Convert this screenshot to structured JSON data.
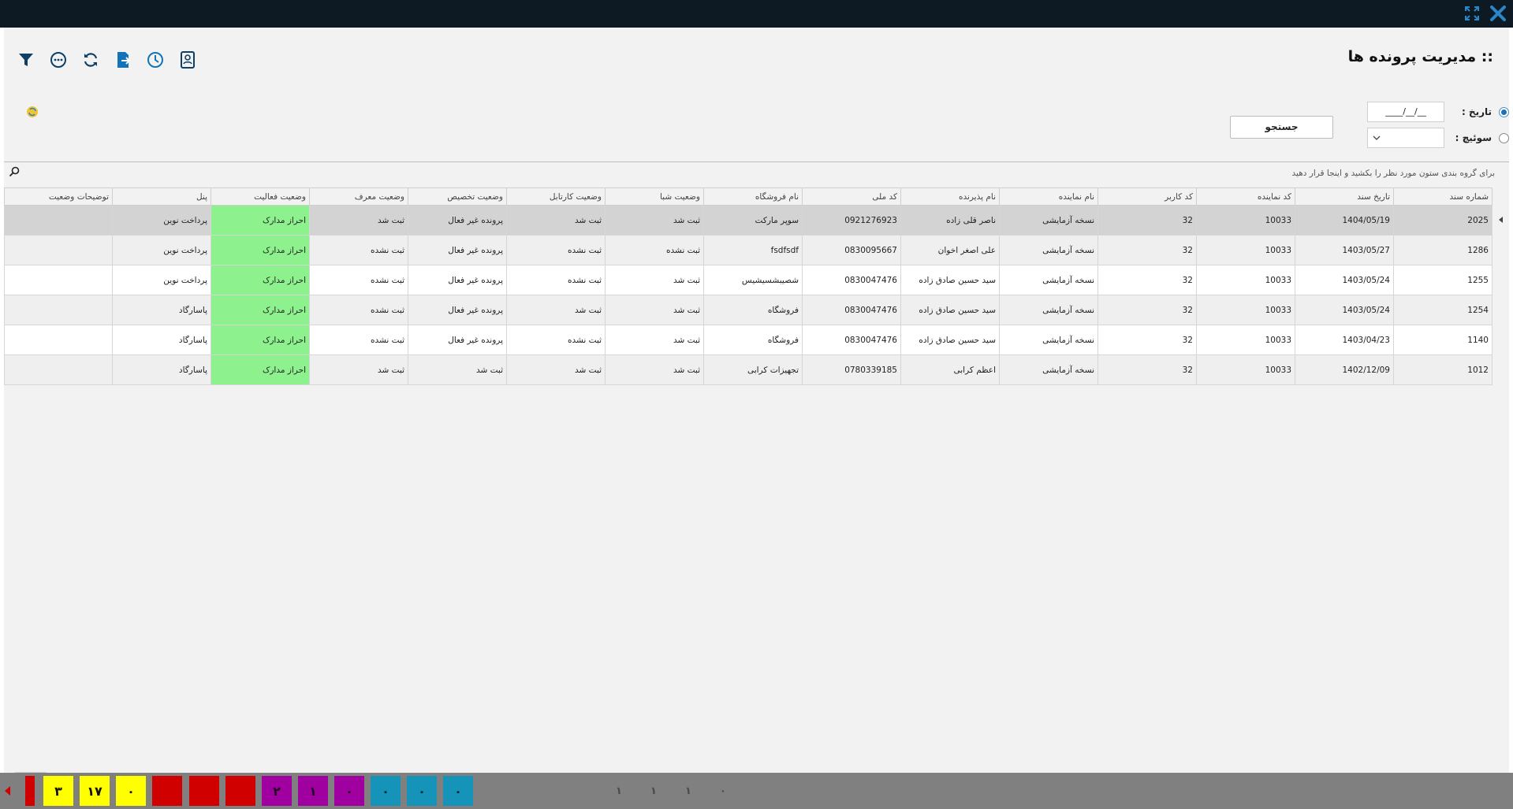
{
  "page": {
    "title": ":: مدیریت پرونده ها"
  },
  "toolbar": {
    "icons": [
      "filter-icon",
      "more-icon",
      "refresh-icon",
      "export-icon",
      "history-icon",
      "contact-card-icon"
    ]
  },
  "filters": {
    "date_label": "تاریخ :",
    "date_value": "__/__/____",
    "switch_label": "سوئیچ :",
    "switch_value": "",
    "search_button": "جستجو"
  },
  "group_hint": "برای گروه بندی ستون مورد نظر را بکشید و اینجا قرار دهید",
  "table": {
    "columns": [
      "شماره سند",
      "تاریخ سند",
      "کد نماینده",
      "کد کاربر",
      "نام نماینده",
      "نام پذیرنده",
      "کد ملی",
      "نام فروشگاه",
      "وضعیت شبا",
      "وضعیت کارتابل",
      "وضعیت تخصیص",
      "وضعیت معرف",
      "وضعیت فعالیت",
      "پنل",
      "توضیحات وضعیت"
    ],
    "rows": [
      [
        "2025",
        "1404/05/19",
        "10033",
        "32",
        "نسخه آزمایشی",
        "ناصر قلی زاده",
        "0921276923",
        "سوپر مارکت",
        "ثبت شد",
        "ثبت شد",
        "پرونده غیر فعال",
        "ثبت شد",
        "احراز مدارک",
        "پرداخت نوین",
        ""
      ],
      [
        "1286",
        "1403/05/27",
        "10033",
        "32",
        "نسخه آزمایشی",
        "علی اصغر اخوان",
        "0830095667",
        "fsdfsdf",
        "ثبت نشده",
        "ثبت نشده",
        "پرونده غیر فعال",
        "ثبت نشده",
        "احراز مدارک",
        "پرداخت نوین",
        ""
      ],
      [
        "1255",
        "1403/05/24",
        "10033",
        "32",
        "نسخه آزمایشی",
        "سید حسین صادق زاده",
        "0830047476",
        "شصیبشسیشیس",
        "ثبت شد",
        "ثبت نشده",
        "پرونده غیر فعال",
        "ثبت نشده",
        "احراز مدارک",
        "پرداخت نوین",
        ""
      ],
      [
        "1254",
        "1403/05/24",
        "10033",
        "32",
        "نسخه آزمایشی",
        "سید حسین صادق زاده",
        "0830047476",
        "فروشگاه",
        "ثبت شد",
        "ثبت شد",
        "پرونده غیر فعال",
        "ثبت نشده",
        "احراز مدارک",
        "پاسارگاد",
        ""
      ],
      [
        "1140",
        "1403/04/23",
        "10033",
        "32",
        "نسخه آزمایشی",
        "سید حسین صادق زاده",
        "0830047476",
        "فروشگاه",
        "ثبت شد",
        "ثبت نشده",
        "پرونده غیر فعال",
        "ثبت نشده",
        "احراز مدارک",
        "پاسارگاد",
        ""
      ],
      [
        "1012",
        "1402/12/09",
        "10033",
        "32",
        "نسخه آزمایشی",
        "اعظم  کرابی",
        "0780339185",
        "تجهیزات کرابی",
        "ثبت شد",
        "ثبت شد",
        "ثبت شد",
        "ثبت شد",
        "احراز مدارک",
        "پاسارگاد",
        ""
      ]
    ]
  },
  "taskbar": {
    "tiles": [
      {
        "color": "yellow",
        "label": "۳"
      },
      {
        "color": "yellow",
        "label": "۱۷"
      },
      {
        "color": "yellow",
        "label": "۰"
      },
      {
        "color": "red",
        "label": ""
      },
      {
        "color": "red",
        "label": ""
      },
      {
        "color": "red",
        "label": ""
      },
      {
        "color": "purple",
        "label": "۲"
      },
      {
        "color": "purple",
        "label": "۱"
      },
      {
        "color": "purple",
        "label": "۰"
      },
      {
        "color": "teal",
        "label": "۰"
      },
      {
        "color": "teal",
        "label": "۰"
      },
      {
        "color": "teal",
        "label": "۰"
      }
    ],
    "mid_icons": [
      {
        "name": "document-count-icon",
        "label": "۱"
      },
      {
        "name": "timer-count-icon",
        "label": "۱"
      },
      {
        "name": "search-count-icon",
        "label": "۱"
      },
      {
        "name": "edit-count-icon",
        "label": "۰"
      }
    ]
  },
  "colors": {
    "topbar": "#0d1a24",
    "accent": "#1d6fb8",
    "status_green": "#8df28d",
    "tile_yellow": "#ffff00",
    "tile_red": "#d10000",
    "tile_purple": "#a000a0",
    "tile_teal": "#1593b8"
  }
}
